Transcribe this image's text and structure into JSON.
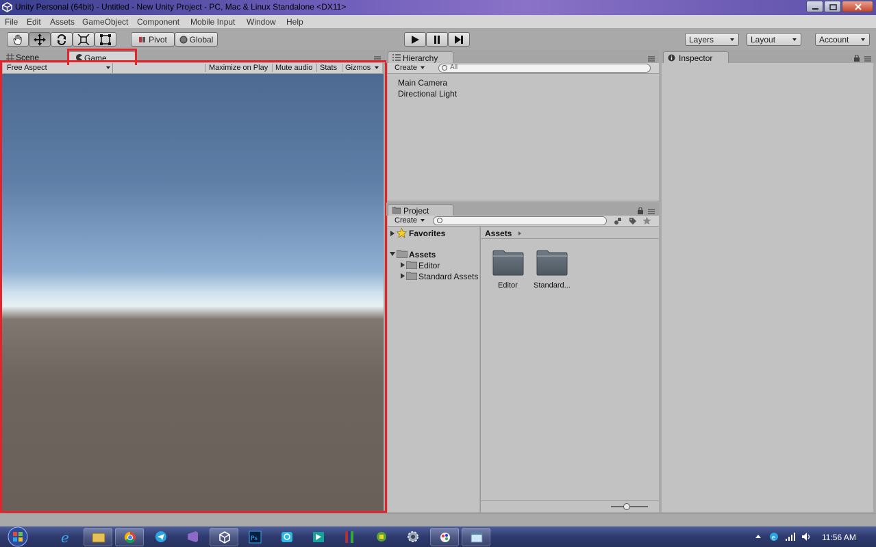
{
  "window": {
    "title": "Unity Personal (64bit) - Untitled - New Unity Project - PC, Mac & Linux Standalone <DX11>"
  },
  "menu": [
    "File",
    "Edit",
    "Assets",
    "GameObject",
    "Component",
    "Mobile Input",
    "Window",
    "Help"
  ],
  "toolbar": {
    "tools": [
      "hand-icon",
      "move-icon",
      "rotate-icon",
      "scale-icon",
      "rect-icon"
    ],
    "pivot_label": "Pivot",
    "global_label": "Global",
    "play_controls": [
      "play-icon",
      "pause-icon",
      "step-icon"
    ],
    "layers_label": "Layers",
    "layout_label": "Layout",
    "account_label": "Account"
  },
  "scene_game": {
    "tab_scene": "Scene",
    "tab_game": "Game",
    "aspect": "Free Aspect",
    "maximize": "Maximize on Play",
    "mute": "Mute audio",
    "stats": "Stats",
    "gizmos": "Gizmos"
  },
  "hierarchy": {
    "tab": "Hierarchy",
    "create": "Create",
    "search_placeholder": "All",
    "items": [
      "Main Camera",
      "Directional Light"
    ]
  },
  "project": {
    "tab": "Project",
    "create": "Create",
    "favorites": "Favorites",
    "assets": "Assets",
    "tree_children": [
      "Editor",
      "Standard Assets"
    ],
    "breadcrumb": "Assets",
    "grid_items": [
      "Editor",
      "Standard..."
    ]
  },
  "inspector": {
    "tab": "Inspector"
  },
  "taskbar": {
    "time": "11:56 AM",
    "colors": {
      "highlight": "#e3242b"
    }
  }
}
